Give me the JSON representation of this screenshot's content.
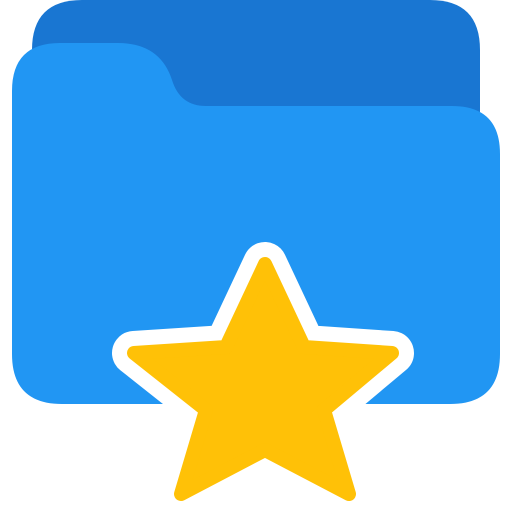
{
  "icon": {
    "name": "favorite-folder-icon",
    "parts": [
      "folder-icon",
      "star-icon"
    ]
  },
  "colors": {
    "background": "#ffffff",
    "folder_back": "#1976D2",
    "folder_front": "#2196F3",
    "star_fill": "#FFC107",
    "star_outline": "#ffffff"
  }
}
